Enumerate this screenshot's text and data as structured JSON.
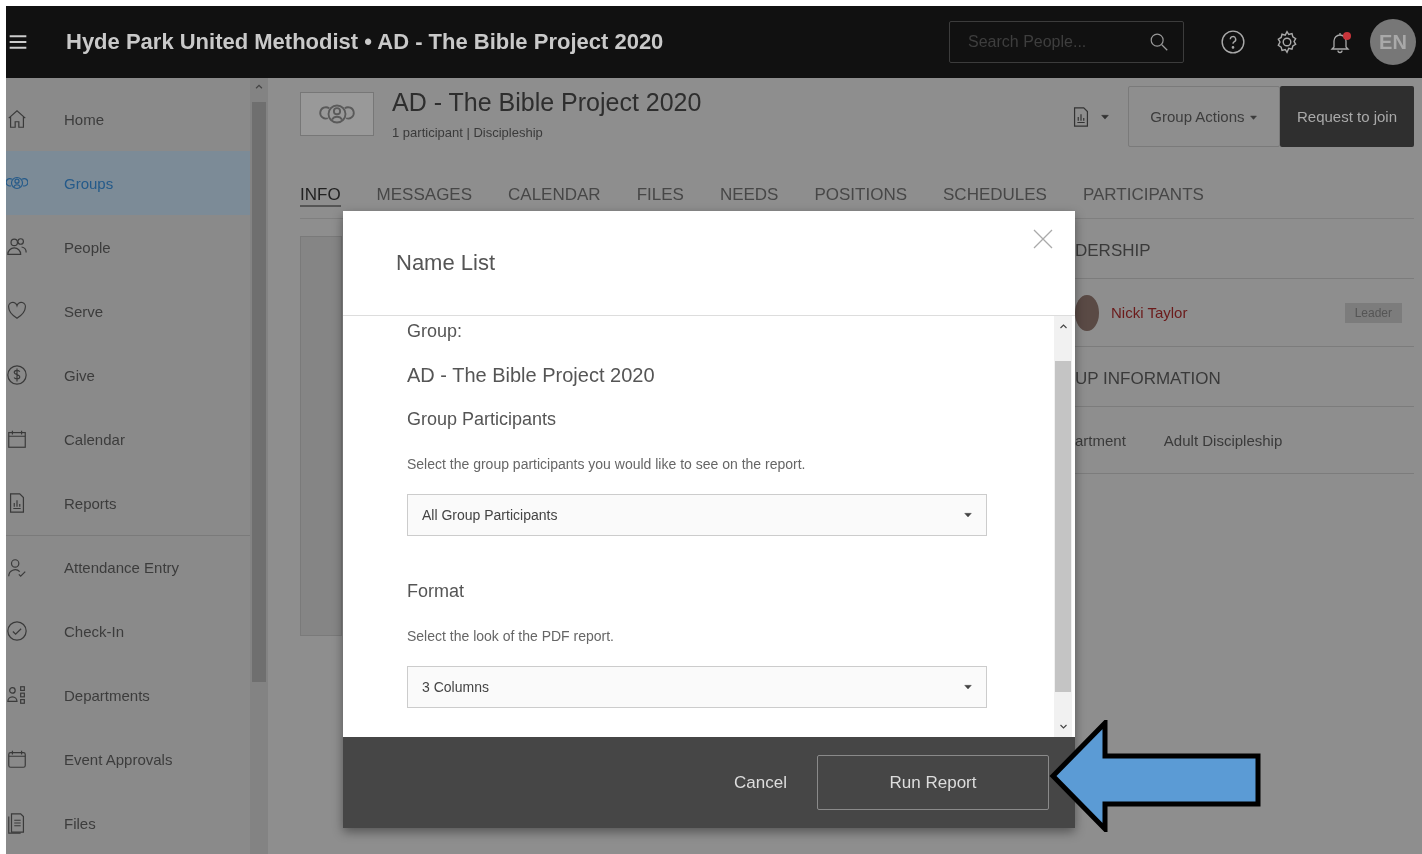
{
  "header": {
    "title": "Hyde Park United Methodist • AD - The Bible Project 2020",
    "search": {
      "placeholder": "Search People..."
    },
    "avatar_initials": "EN",
    "notification_dot": true
  },
  "sidebar": {
    "items": [
      {
        "kind": "home",
        "label": "Home",
        "selected": false,
        "section_start": false
      },
      {
        "kind": "groups",
        "label": "Groups",
        "selected": true,
        "section_start": false
      },
      {
        "kind": "people",
        "label": "People",
        "selected": false,
        "section_start": false
      },
      {
        "kind": "heart",
        "label": "Serve",
        "selected": false,
        "section_start": false
      },
      {
        "kind": "dollar",
        "label": "Give",
        "selected": false,
        "section_start": false
      },
      {
        "kind": "calendar",
        "label": "Calendar",
        "selected": false,
        "section_start": false
      },
      {
        "kind": "report",
        "label": "Reports",
        "selected": false,
        "section_start": false
      },
      {
        "kind": "person-check",
        "label": "Attendance Entry",
        "selected": false,
        "section_start": true
      },
      {
        "kind": "check",
        "label": "Check-In",
        "selected": false,
        "section_start": false
      },
      {
        "kind": "departments",
        "label": "Departments",
        "selected": false,
        "section_start": false
      },
      {
        "kind": "event",
        "label": "Event Approvals",
        "selected": false,
        "section_start": false
      },
      {
        "kind": "files",
        "label": "Files",
        "selected": false,
        "section_start": false
      }
    ]
  },
  "group": {
    "name": "AD - The Bible Project 2020",
    "subtitle": "1 participant | Discipleship",
    "group_actions": "Group Actions",
    "request_join": "Request to join",
    "tabs": [
      {
        "label": "INFO",
        "selected": true
      },
      {
        "label": "MESSAGES",
        "selected": false
      },
      {
        "label": "CALENDAR",
        "selected": false
      },
      {
        "label": "FILES",
        "selected": false
      },
      {
        "label": "NEEDS",
        "selected": false
      },
      {
        "label": "POSITIONS",
        "selected": false
      },
      {
        "label": "SCHEDULES",
        "selected": false
      },
      {
        "label": "PARTICIPANTS",
        "selected": false
      }
    ],
    "side_panel": {
      "leadership_heading": "DERSHIP",
      "leader": {
        "name": "Nicki Taylor",
        "role": "Leader"
      },
      "info_heading": "UP INFORMATION",
      "info_rows": [
        {
          "label": "artment",
          "value": "Adult Discipleship"
        }
      ]
    }
  },
  "modal": {
    "title": "Name List",
    "group_label": "Group:",
    "group_value": "AD - The Bible Project 2020",
    "sections": [
      {
        "heading": "Group Participants",
        "hint": "Select the group participants you would like to see on the report.",
        "value": "All Group Participants"
      },
      {
        "heading": "Format",
        "hint": "Select the look of the PDF report.",
        "value": "3 Columns"
      }
    ],
    "buttons": {
      "cancel": "Cancel",
      "run": "Run Report"
    }
  }
}
